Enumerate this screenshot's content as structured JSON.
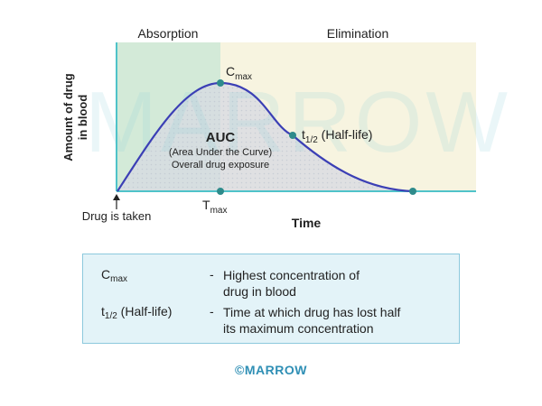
{
  "diagram": {
    "phases": {
      "absorption": "Absorption",
      "elimination": "Elimination"
    },
    "y_axis_label_line1": "Amount of drug",
    "y_axis_label_line2": "in blood",
    "x_axis_label": "Time",
    "drug_taken_label": "Drug is taken",
    "cmax": {
      "main": "C",
      "sub": "max"
    },
    "tmax": {
      "main": "T",
      "sub": "max"
    },
    "half_life": {
      "main": "t",
      "sub": "1/2",
      "suffix": " (Half-life)"
    },
    "auc_title": "AUC",
    "auc_line1": "(Area Under the Curve)",
    "auc_line2": "Overall drug exposure",
    "watermark": "MARROW",
    "colors": {
      "absorption_region": "#d3ead8",
      "elimination_region": "#f7f4e0",
      "curve": "#3b3fb5",
      "points": "#2e8b8b",
      "axis": "#4fc3c9"
    }
  },
  "legend": {
    "rows": [
      {
        "term": "C",
        "term_sub": "max",
        "term_suffix": "",
        "dash": "-",
        "definition_line1": "Highest concentration of",
        "definition_line2": "drug in blood"
      },
      {
        "term": "t",
        "term_sub": "1/2",
        "term_suffix": " (Half-life)",
        "dash": "-",
        "definition_line1": "Time at which drug has lost half",
        "definition_line2": "its maximum concentration"
      }
    ]
  },
  "copyright": "©MARROW"
}
